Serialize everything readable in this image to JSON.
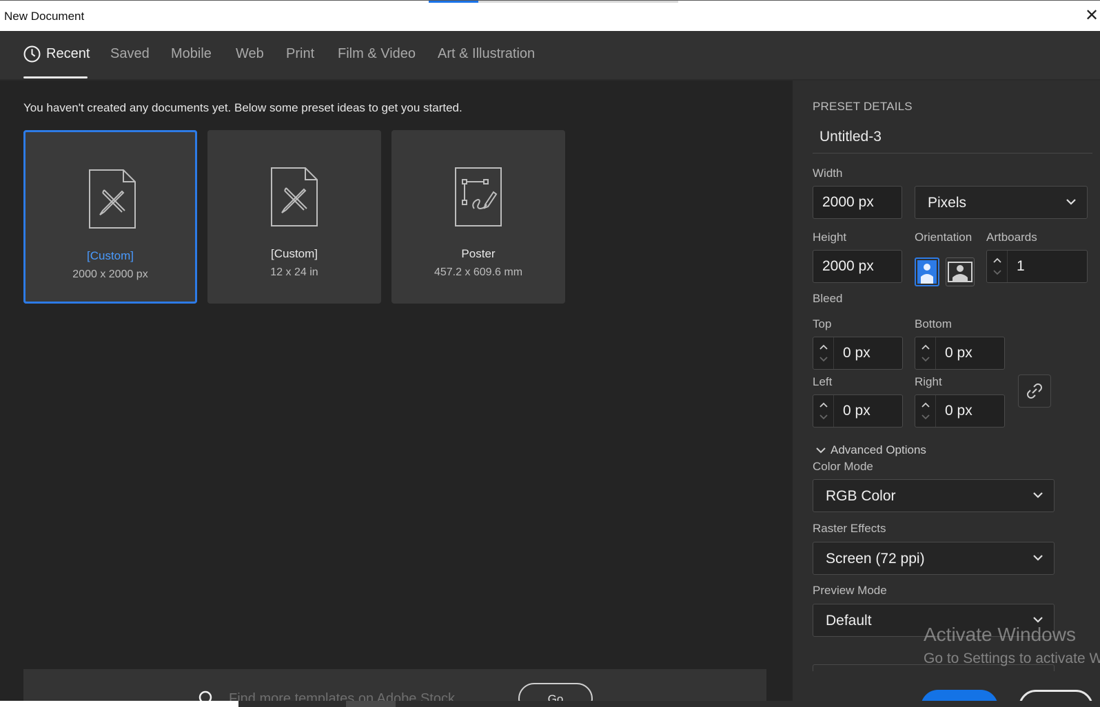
{
  "window": {
    "title": "New Document",
    "close_glyph": "✕"
  },
  "tabs": [
    {
      "label": "Recent",
      "active": true
    },
    {
      "label": "Saved"
    },
    {
      "label": "Mobile"
    },
    {
      "label": "Web"
    },
    {
      "label": "Print"
    },
    {
      "label": "Film & Video"
    },
    {
      "label": "Art & Illustration"
    }
  ],
  "intro_text": "You haven't created any documents yet. Below some preset ideas to get you started.",
  "presets": [
    {
      "name": "[Custom]",
      "dims": "2000 x 2000 px",
      "icon": "document-pencil-ruler-icon",
      "selected": true
    },
    {
      "name": "[Custom]",
      "dims": "12 x 24 in",
      "icon": "document-pencil-ruler-icon"
    },
    {
      "name": "Poster",
      "dims": "457.2 x 609.6 mm",
      "icon": "document-pen-path-icon"
    }
  ],
  "stock": {
    "placeholder": "Find more templates on Adobe Stock",
    "go_label": "Go"
  },
  "details": {
    "header": "PRESET DETAILS",
    "doc_name": "Untitled-3",
    "width_label": "Width",
    "width_value": "2000 px",
    "units": "Pixels",
    "height_label": "Height",
    "height_value": "2000 px",
    "orientation_label": "Orientation",
    "artboards_label": "Artboards",
    "artboards_value": "1",
    "bleed_label": "Bleed",
    "top_label": "Top",
    "top_value": "0 px",
    "bottom_label": "Bottom",
    "bottom_value": "0 px",
    "left_label": "Left",
    "left_value": "0 px",
    "right_label": "Right",
    "right_value": "0 px",
    "advanced_label": "Advanced Options",
    "color_mode_label": "Color Mode",
    "color_mode_value": "RGB Color",
    "raster_label": "Raster Effects",
    "raster_value": "Screen (72 ppi)",
    "preview_label": "Preview Mode",
    "preview_value": "Default"
  },
  "watermark": {
    "line1": "Activate Windows",
    "line2": "Go to Settings to activate W"
  },
  "colors": {
    "accent": "#1473e6",
    "background": "#232323",
    "panel": "#2e2e2e"
  }
}
